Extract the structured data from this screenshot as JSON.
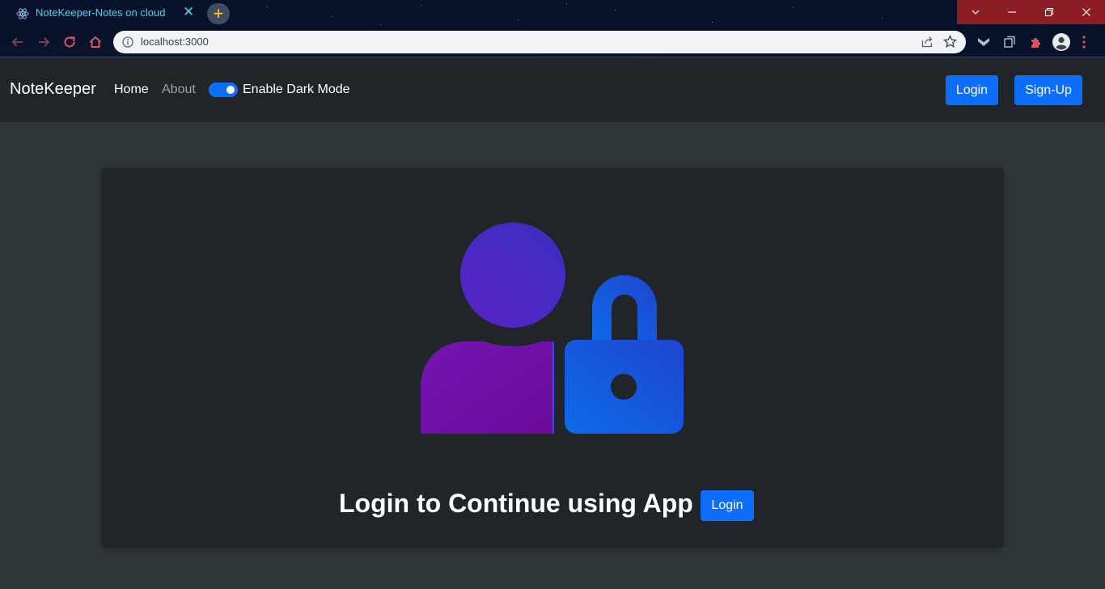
{
  "browser": {
    "tab_title": "NoteKeeper-Notes on cloud",
    "url": "localhost:3000",
    "icons": [
      "react-favicon-icon",
      "close-icon",
      "plus-icon",
      "chevron-down-icon",
      "minimize-icon",
      "restore-icon",
      "close-window-icon",
      "back-icon",
      "forward-icon",
      "reload-icon",
      "home-icon",
      "info-icon",
      "share-icon",
      "star-icon",
      "extension-icon",
      "puzzle-icon",
      "profile-icon",
      "menu-icon"
    ]
  },
  "navbar": {
    "brand": "NoteKeeper",
    "links": {
      "home": "Home",
      "about": "About"
    },
    "dark_mode_label": "Enable Dark Mode",
    "dark_mode_enabled": true,
    "login": "Login",
    "signup": "Sign-Up"
  },
  "main": {
    "illustration": "user-lock-icon",
    "message": "Login to Continue using App",
    "login_button": "Login"
  },
  "colors": {
    "primary": "#0d6efd",
    "navbar_bg": "#212529",
    "page_bg": "#2f3639",
    "card_bg": "#212529",
    "tab_text": "#40d8f0",
    "window_controls": "#8c1d24",
    "illustration_purple": "#6a0fa0",
    "illustration_blue": "#0d5fe0"
  }
}
